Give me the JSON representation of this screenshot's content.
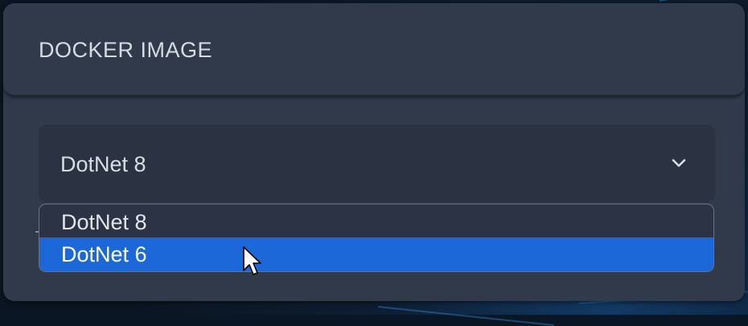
{
  "panel": {
    "title": "DOCKER IMAGE"
  },
  "select": {
    "value": "DotNet 8",
    "expand_icon": "chevron-down-icon",
    "options": [
      {
        "label": "DotNet 8"
      },
      {
        "label": "DotNet 6",
        "highlighted": true
      }
    ]
  },
  "colors": {
    "panel_bg": "#303a4a",
    "select_bg": "#2b3242",
    "highlight": "#1c68d8",
    "text": "#d9dde4"
  },
  "pointer": "arrow-cursor-icon"
}
